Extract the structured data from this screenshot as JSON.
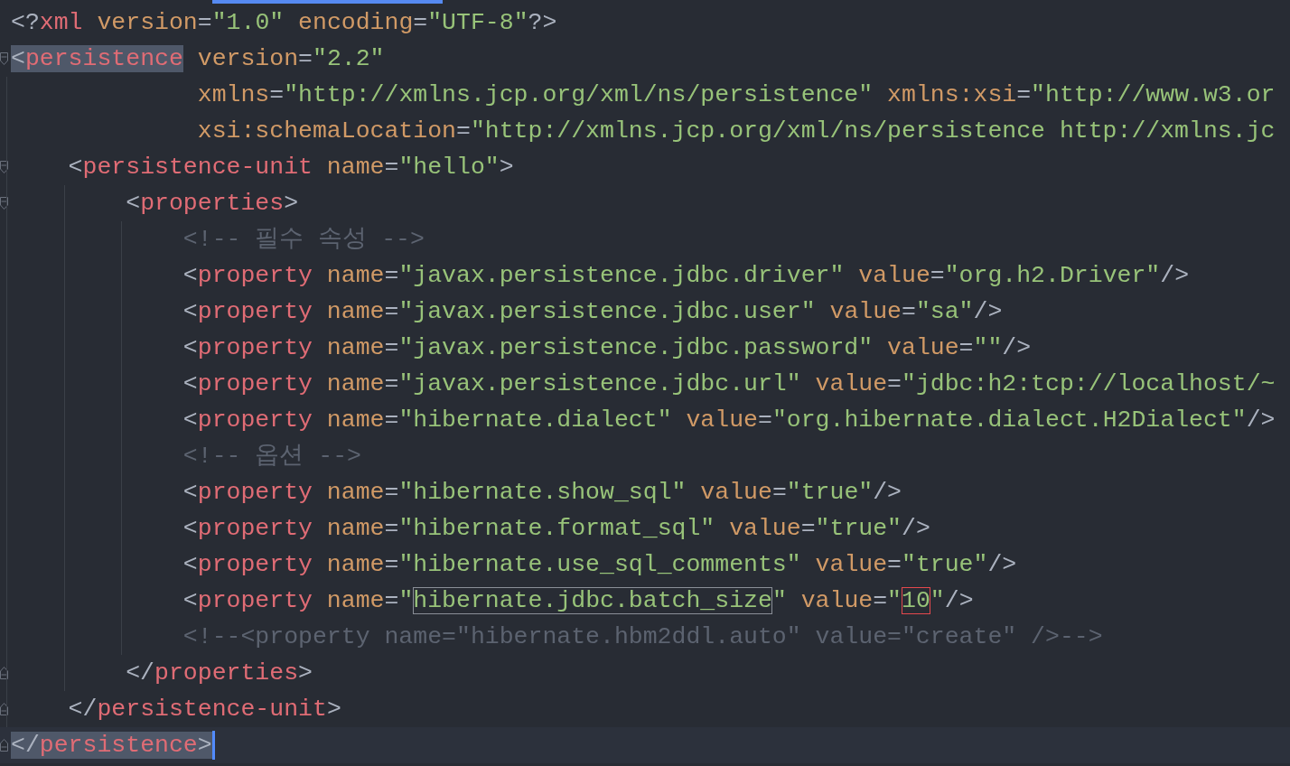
{
  "editor": {
    "lines": [
      {
        "tokens": [
          {
            "kind": "punct",
            "text": "<?"
          },
          {
            "kind": "tag",
            "text": "xml"
          },
          {
            "kind": "attr",
            "text": " version"
          },
          {
            "kind": "punct",
            "text": "="
          },
          {
            "kind": "string",
            "text": "\"1.0\""
          },
          {
            "kind": "attr",
            "text": " encoding"
          },
          {
            "kind": "punct",
            "text": "="
          },
          {
            "kind": "string",
            "text": "\"UTF-8\""
          },
          {
            "kind": "punct",
            "text": "?>"
          }
        ]
      },
      {
        "fold_start": true,
        "tokens": [
          {
            "kind": "punct",
            "text": "<",
            "selected": true
          },
          {
            "kind": "tag",
            "text": "persistence",
            "selected": true
          },
          {
            "kind": "attr",
            "text": " version"
          },
          {
            "kind": "punct",
            "text": "="
          },
          {
            "kind": "string",
            "text": "\"2.2\""
          }
        ]
      },
      {
        "tokens": [
          {
            "kind": "attr",
            "text": "             xmlns"
          },
          {
            "kind": "punct",
            "text": "="
          },
          {
            "kind": "string",
            "text": "\"http://xmlns.jcp.org/xml/ns/persistence\""
          },
          {
            "kind": "attr",
            "text": " xmlns:xsi"
          },
          {
            "kind": "punct",
            "text": "="
          },
          {
            "kind": "string",
            "text": "\"http://www.w3.or"
          }
        ]
      },
      {
        "tokens": [
          {
            "kind": "attr",
            "text": "             xsi:schemaLocation"
          },
          {
            "kind": "punct",
            "text": "="
          },
          {
            "kind": "string",
            "text": "\"http://xmlns.jcp.org/xml/ns/persistence http://xmlns.jc"
          }
        ]
      },
      {
        "fold_start": true,
        "tokens": [
          {
            "kind": "punct",
            "text": "    <"
          },
          {
            "kind": "tag",
            "text": "persistence-unit"
          },
          {
            "kind": "attr",
            "text": " name"
          },
          {
            "kind": "punct",
            "text": "="
          },
          {
            "kind": "string",
            "text": "\"hello\""
          },
          {
            "kind": "punct",
            "text": ">"
          }
        ]
      },
      {
        "fold_start": true,
        "tokens": [
          {
            "kind": "punct",
            "text": "        <"
          },
          {
            "kind": "tag",
            "text": "properties"
          },
          {
            "kind": "punct",
            "text": ">"
          }
        ]
      },
      {
        "tokens": [
          {
            "kind": "comment",
            "text": "            <!-- 필수 속성 -->"
          }
        ]
      },
      {
        "tokens": [
          {
            "kind": "punct",
            "text": "            <"
          },
          {
            "kind": "tag",
            "text": "property"
          },
          {
            "kind": "attr",
            "text": " name"
          },
          {
            "kind": "punct",
            "text": "="
          },
          {
            "kind": "string",
            "text": "\"javax.persistence.jdbc.driver\""
          },
          {
            "kind": "attr",
            "text": " value"
          },
          {
            "kind": "punct",
            "text": "="
          },
          {
            "kind": "string",
            "text": "\"org.h2.Driver\""
          },
          {
            "kind": "punct",
            "text": "/>"
          }
        ]
      },
      {
        "tokens": [
          {
            "kind": "punct",
            "text": "            <"
          },
          {
            "kind": "tag",
            "text": "property"
          },
          {
            "kind": "attr",
            "text": " name"
          },
          {
            "kind": "punct",
            "text": "="
          },
          {
            "kind": "string",
            "text": "\"javax.persistence.jdbc.user\""
          },
          {
            "kind": "attr",
            "text": " value"
          },
          {
            "kind": "punct",
            "text": "="
          },
          {
            "kind": "string",
            "text": "\"sa\""
          },
          {
            "kind": "punct",
            "text": "/>"
          }
        ]
      },
      {
        "tokens": [
          {
            "kind": "punct",
            "text": "            <"
          },
          {
            "kind": "tag",
            "text": "property"
          },
          {
            "kind": "attr",
            "text": " name"
          },
          {
            "kind": "punct",
            "text": "="
          },
          {
            "kind": "string",
            "text": "\"javax.persistence.jdbc.password\""
          },
          {
            "kind": "attr",
            "text": " value"
          },
          {
            "kind": "punct",
            "text": "="
          },
          {
            "kind": "string",
            "text": "\"\""
          },
          {
            "kind": "punct",
            "text": "/>"
          }
        ]
      },
      {
        "tokens": [
          {
            "kind": "punct",
            "text": "            <"
          },
          {
            "kind": "tag",
            "text": "property"
          },
          {
            "kind": "attr",
            "text": " name"
          },
          {
            "kind": "punct",
            "text": "="
          },
          {
            "kind": "string",
            "text": "\"javax.persistence.jdbc.url\""
          },
          {
            "kind": "attr",
            "text": " value"
          },
          {
            "kind": "punct",
            "text": "="
          },
          {
            "kind": "string",
            "text": "\"jdbc:h2:tcp://localhost/~"
          }
        ]
      },
      {
        "tokens": [
          {
            "kind": "punct",
            "text": "            <"
          },
          {
            "kind": "tag",
            "text": "property"
          },
          {
            "kind": "attr",
            "text": " name"
          },
          {
            "kind": "punct",
            "text": "="
          },
          {
            "kind": "string",
            "text": "\"hibernate.dialect\""
          },
          {
            "kind": "attr",
            "text": " value"
          },
          {
            "kind": "punct",
            "text": "="
          },
          {
            "kind": "string",
            "text": "\"org.hibernate.dialect.H2Dialect\""
          },
          {
            "kind": "punct",
            "text": "/>"
          }
        ]
      },
      {
        "tokens": [
          {
            "kind": "comment",
            "text": "            <!-- 옵션 -->"
          }
        ]
      },
      {
        "tokens": [
          {
            "kind": "punct",
            "text": "            <"
          },
          {
            "kind": "tag",
            "text": "property"
          },
          {
            "kind": "attr",
            "text": " name"
          },
          {
            "kind": "punct",
            "text": "="
          },
          {
            "kind": "string",
            "text": "\"hibernate.show_sql\""
          },
          {
            "kind": "attr",
            "text": " value"
          },
          {
            "kind": "punct",
            "text": "="
          },
          {
            "kind": "string",
            "text": "\"true\""
          },
          {
            "kind": "punct",
            "text": "/>"
          }
        ]
      },
      {
        "tokens": [
          {
            "kind": "punct",
            "text": "            <"
          },
          {
            "kind": "tag",
            "text": "property"
          },
          {
            "kind": "attr",
            "text": " name"
          },
          {
            "kind": "punct",
            "text": "="
          },
          {
            "kind": "string",
            "text": "\"hibernate.format_sql\""
          },
          {
            "kind": "attr",
            "text": " value"
          },
          {
            "kind": "punct",
            "text": "="
          },
          {
            "kind": "string",
            "text": "\"true\""
          },
          {
            "kind": "punct",
            "text": "/>"
          }
        ]
      },
      {
        "tokens": [
          {
            "kind": "punct",
            "text": "            <"
          },
          {
            "kind": "tag",
            "text": "property"
          },
          {
            "kind": "attr",
            "text": " name"
          },
          {
            "kind": "punct",
            "text": "="
          },
          {
            "kind": "string",
            "text": "\"hibernate.use_sql_comments\""
          },
          {
            "kind": "attr",
            "text": " value"
          },
          {
            "kind": "punct",
            "text": "="
          },
          {
            "kind": "string",
            "text": "\"true\""
          },
          {
            "kind": "punct",
            "text": "/>"
          }
        ]
      },
      {
        "tokens": [
          {
            "kind": "punct",
            "text": "            <"
          },
          {
            "kind": "tag",
            "text": "property"
          },
          {
            "kind": "attr",
            "text": " name"
          },
          {
            "kind": "punct",
            "text": "="
          },
          {
            "kind": "string",
            "text": "\""
          },
          {
            "kind": "string",
            "text": "hibernate.jdbc.batch_size",
            "match": true
          },
          {
            "kind": "string",
            "text": "\""
          },
          {
            "kind": "attr",
            "text": " value"
          },
          {
            "kind": "punct",
            "text": "="
          },
          {
            "kind": "string",
            "text": "\""
          },
          {
            "kind": "string",
            "text": "10",
            "error": true
          },
          {
            "kind": "string",
            "text": "\""
          },
          {
            "kind": "punct",
            "text": "/>"
          }
        ]
      },
      {
        "tokens": [
          {
            "kind": "comment",
            "text": "            <!--<property name=\"hibernate.hbm2ddl.auto\" value=\"create\" />-->"
          }
        ]
      },
      {
        "fold_end": true,
        "tokens": [
          {
            "kind": "punct",
            "text": "        </"
          },
          {
            "kind": "tag",
            "text": "properties"
          },
          {
            "kind": "punct",
            "text": ">"
          }
        ]
      },
      {
        "fold_end": true,
        "tokens": [
          {
            "kind": "punct",
            "text": "    </"
          },
          {
            "kind": "tag",
            "text": "persistence-unit"
          },
          {
            "kind": "punct",
            "text": ">"
          }
        ]
      },
      {
        "fold_end": true,
        "current": true,
        "caret": true,
        "tokens": [
          {
            "kind": "punct",
            "text": "</",
            "selected": true
          },
          {
            "kind": "tag",
            "text": "persistence",
            "selected": true
          },
          {
            "kind": "punct",
            "text": ">",
            "selected": true
          }
        ]
      }
    ]
  }
}
